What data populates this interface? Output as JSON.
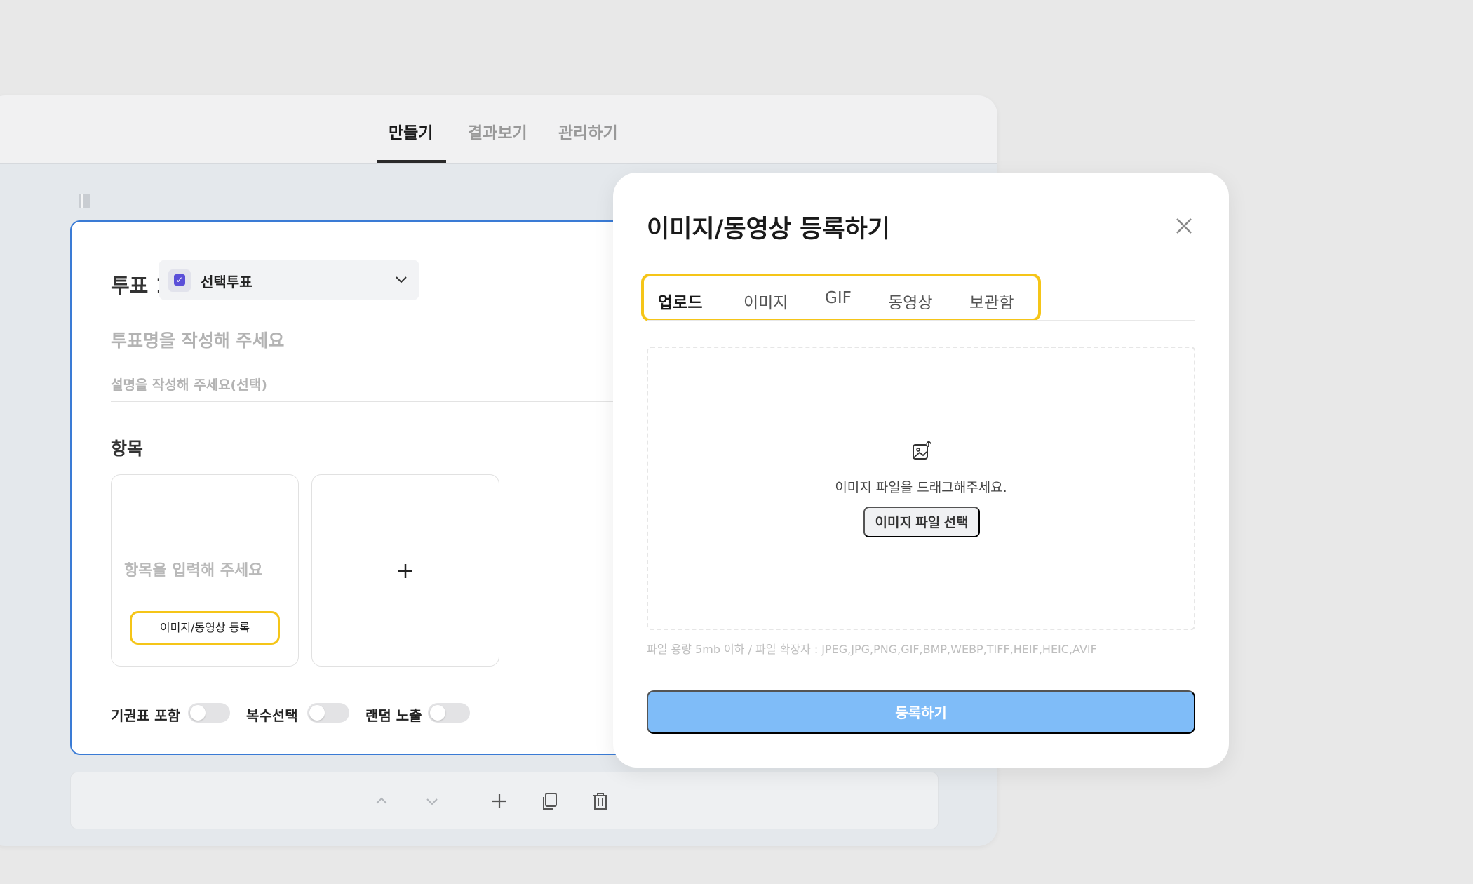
{
  "app": {
    "tabs": [
      {
        "label": "만들기"
      },
      {
        "label": "결과보기"
      },
      {
        "label": "관리하기"
      }
    ]
  },
  "poll": {
    "title": "투표 1",
    "type_label": "선택투표",
    "name_placeholder": "투표명을 작성해 주세요",
    "desc_placeholder": "설명을 작성해 주세요(선택)",
    "items_heading": "항목",
    "item_placeholder": "항목을 입력해 주세요",
    "media_button": "이미지/동영상 등록",
    "toggles": [
      {
        "label": "기권표 포함",
        "on": false
      },
      {
        "label": "복수선택",
        "on": false
      },
      {
        "label": "랜덤 노출",
        "on": false
      }
    ]
  },
  "modal": {
    "title": "이미지/동영상 등록하기",
    "tabs": [
      {
        "label": "업로드"
      },
      {
        "label": "이미지"
      },
      {
        "label": "GIF"
      },
      {
        "label": "동영상"
      },
      {
        "label": "보관함"
      }
    ],
    "drop_text": "이미지 파일을 드래그해주세요.",
    "file_button": "이미지 파일 선택",
    "file_info": "파일 용량 5mb 이하 / 파일 확장자 : JPEG,JPG,PNG,GIF,BMP,WEBP,TIFF,HEIF,HEIC,AVIF",
    "submit": "등록하기"
  },
  "colors": {
    "accent_blue": "#3a7bd5",
    "highlight_yellow": "#f5c518",
    "submit_disabled": "#7fbcf8",
    "check_purple": "#5a4fd8"
  },
  "icons": [
    "book-icon",
    "check-icon",
    "chevron-down-icon",
    "plus-icon",
    "chevron-up-icon",
    "copy-icon",
    "trash-icon",
    "close-icon",
    "image-upload-icon"
  ]
}
